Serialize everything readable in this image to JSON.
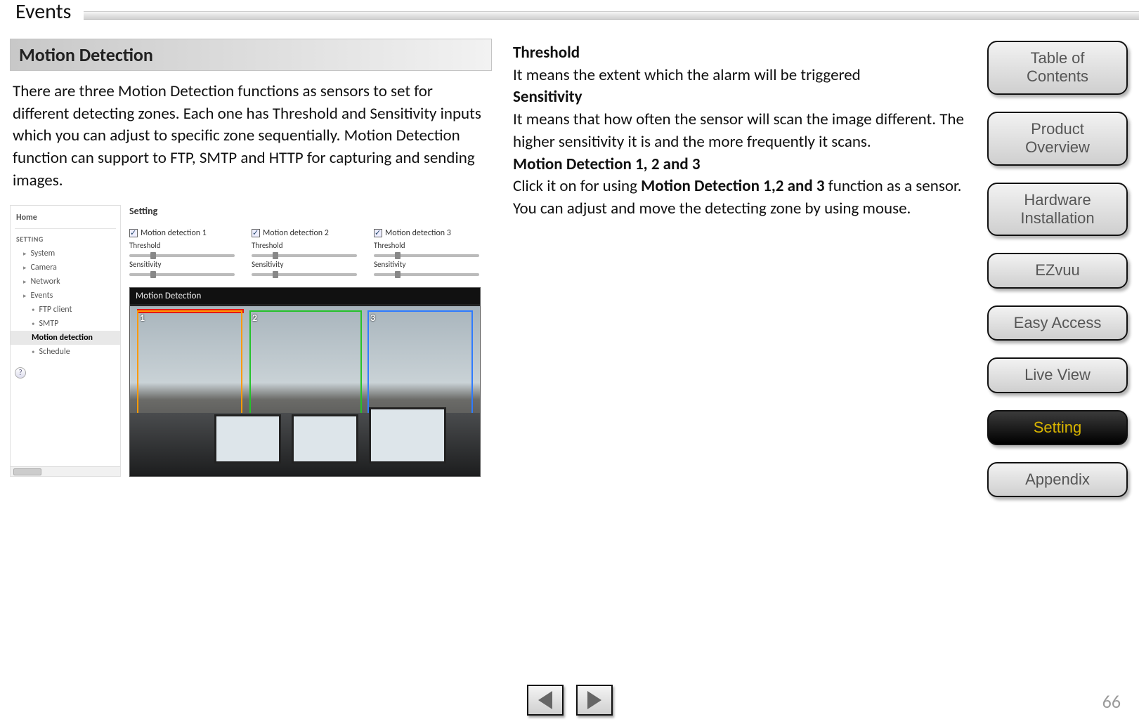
{
  "page": {
    "title": "Events",
    "number": "66"
  },
  "section": {
    "heading": "Motion Detection",
    "intro": "There are three Motion Detection functions as sensors to set for different detecting zones. Each one has Threshold and Sensitivity inputs which you can adjust to specific zone sequentially. Motion Detection function can support to FTP, SMTP and HTTP for capturing and sending images."
  },
  "mock_ui": {
    "home": "Home",
    "setting_header": "SETTING",
    "nav": {
      "system": "System",
      "camera": "Camera",
      "network": "Network",
      "events": "Events",
      "ftp": "FTP client",
      "smtp": "SMTP",
      "motion": "Motion detection",
      "schedule": "Schedule"
    },
    "main_title": "Setting",
    "md": [
      {
        "name": "Motion detection 1",
        "threshold": "Threshold",
        "sensitivity": "Sensitivity"
      },
      {
        "name": "Motion detection 2",
        "threshold": "Threshold",
        "sensitivity": "Sensitivity"
      },
      {
        "name": "Motion detection 3",
        "threshold": "Threshold",
        "sensitivity": "Sensitivity"
      }
    ],
    "video_title": "Motion Detection",
    "zones": {
      "z1": "1",
      "z2": "2",
      "z3": "3"
    }
  },
  "definitions": {
    "threshold_h": "Threshold",
    "threshold_b": "It means the extent which the alarm will be triggered",
    "sensitivity_h": "Sensitivity",
    "sensitivity_b": "It means that how often the sensor will scan the image different. The higher sensitivity it is and the more frequently it scans.",
    "md123_h": "Motion Detection 1, 2 and 3",
    "md123_b1": "Click it on for using ",
    "md123_bold": "Motion Detection 1,2 and 3",
    "md123_b2": " function as a sensor. You can adjust and move the detecting zone by using mouse."
  },
  "nav_buttons": [
    {
      "label": "Table of\nContents",
      "active": false
    },
    {
      "label": "Product\nOverview",
      "active": false
    },
    {
      "label": "Hardware\nInstallation",
      "active": false
    },
    {
      "label": "EZvuu",
      "active": false
    },
    {
      "label": "Easy Access",
      "active": false
    },
    {
      "label": "Live View",
      "active": false
    },
    {
      "label": "Setting",
      "active": true
    },
    {
      "label": "Appendix",
      "active": false
    }
  ]
}
